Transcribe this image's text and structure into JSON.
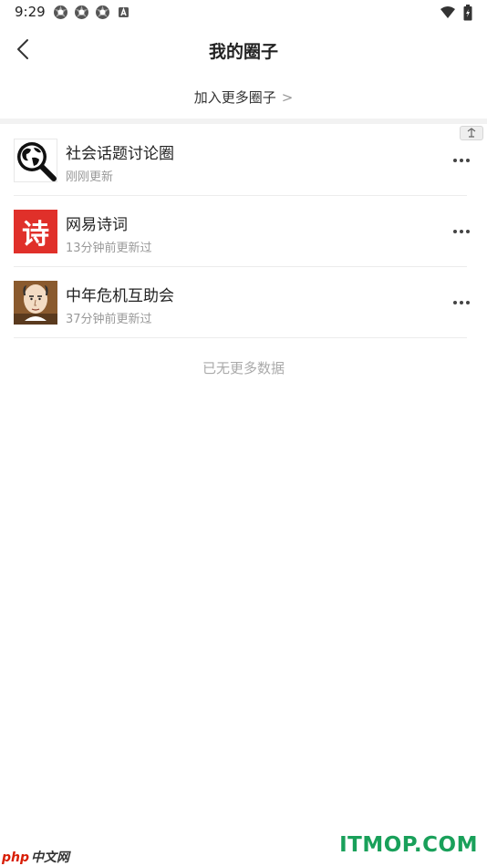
{
  "status_bar": {
    "time": "9:29"
  },
  "header": {
    "title": "我的圈子"
  },
  "join": {
    "label": "加入更多圈子",
    "chevron": ">"
  },
  "circles": [
    {
      "name": "社会话题讨论圈",
      "updated": "刚刚更新",
      "avatar": "globe-magnifier-icon"
    },
    {
      "name": "网易诗词",
      "updated": "13分钟前更新过",
      "avatar_text": "诗",
      "avatar_color": "#e0302a"
    },
    {
      "name": "中年危机互助会",
      "updated": "37分钟前更新过",
      "avatar": "cartoon-man-avatar"
    }
  ],
  "footer": {
    "no_more": "已无更多数据"
  },
  "watermarks": {
    "left_brand": "php",
    "left_cn": "中文网",
    "right": "ITMOP.COM"
  }
}
